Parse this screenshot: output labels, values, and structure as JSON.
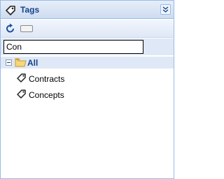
{
  "header": {
    "title": "Tags"
  },
  "search": {
    "value": "Con"
  },
  "tree": {
    "root_label": "All",
    "children": [
      "Contracts",
      "Concepts"
    ]
  },
  "colors": {
    "header_text": "#15428b",
    "border": "#99bbe8"
  }
}
